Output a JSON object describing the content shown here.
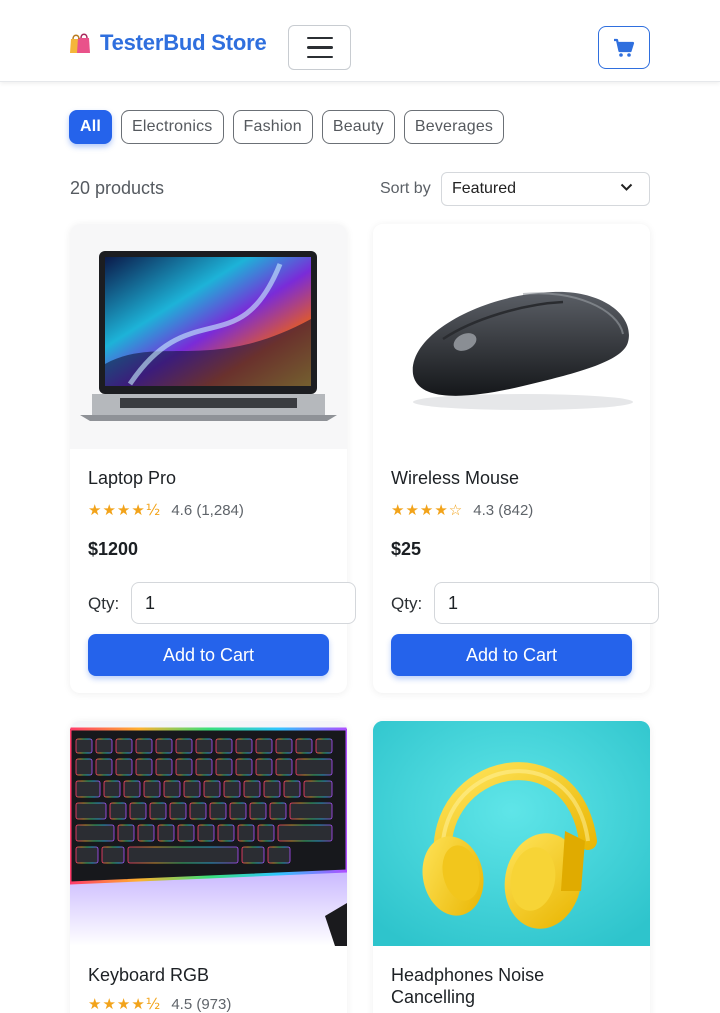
{
  "header": {
    "brand_name": "TesterBud Store",
    "brand_icon": "shopping-bags-icon",
    "menu_icon": "hamburger-menu-icon",
    "cart_icon": "cart-icon",
    "accent_color": "#2563eb"
  },
  "filters": {
    "chips": [
      {
        "label": "All",
        "active": true
      },
      {
        "label": "Electronics",
        "active": false
      },
      {
        "label": "Fashion",
        "active": false
      },
      {
        "label": "Beauty",
        "active": false
      },
      {
        "label": "Beverages",
        "active": false
      }
    ]
  },
  "results": {
    "count_text": "20 products",
    "sort_label": "Sort by",
    "sort_value": "Featured"
  },
  "products": [
    {
      "title": "Laptop Pro",
      "stars": "★★★★½",
      "rating_text": "4.6 (1,284)",
      "price": "$1200",
      "qty_label": "Qty:",
      "qty_value": "1",
      "button": "Add to Cart"
    },
    {
      "title": "Wireless Mouse",
      "stars": "★★★★☆",
      "rating_text": "4.3 (842)",
      "price": "$25",
      "qty_label": "Qty:",
      "qty_value": "1",
      "button": "Add to Cart"
    },
    {
      "title": "Keyboard RGB",
      "stars": "★★★★½",
      "rating_text": "4.5 (973)"
    },
    {
      "title": "Headphones Noise Cancelling"
    }
  ]
}
